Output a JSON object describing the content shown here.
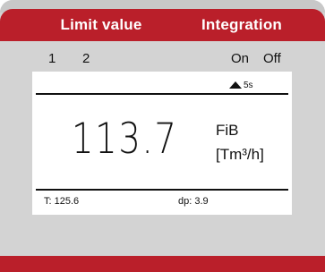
{
  "header": {
    "left_button": "Limit value",
    "right_button": "Integration"
  },
  "softkeys": {
    "key1": "1",
    "key2": "2",
    "on": "On",
    "off": "Off"
  },
  "display": {
    "trend_icon": "up-triangle-icon",
    "interval": "5s",
    "value": "113.7",
    "measurement": "FiB",
    "unit": "[Tm³/h]",
    "temperature": "T: 125.6",
    "differential_pressure": "dp: 3.9"
  },
  "colors": {
    "accent": "#ba1f2a",
    "panel": "#d3d3d3",
    "screen": "#ffffff"
  }
}
